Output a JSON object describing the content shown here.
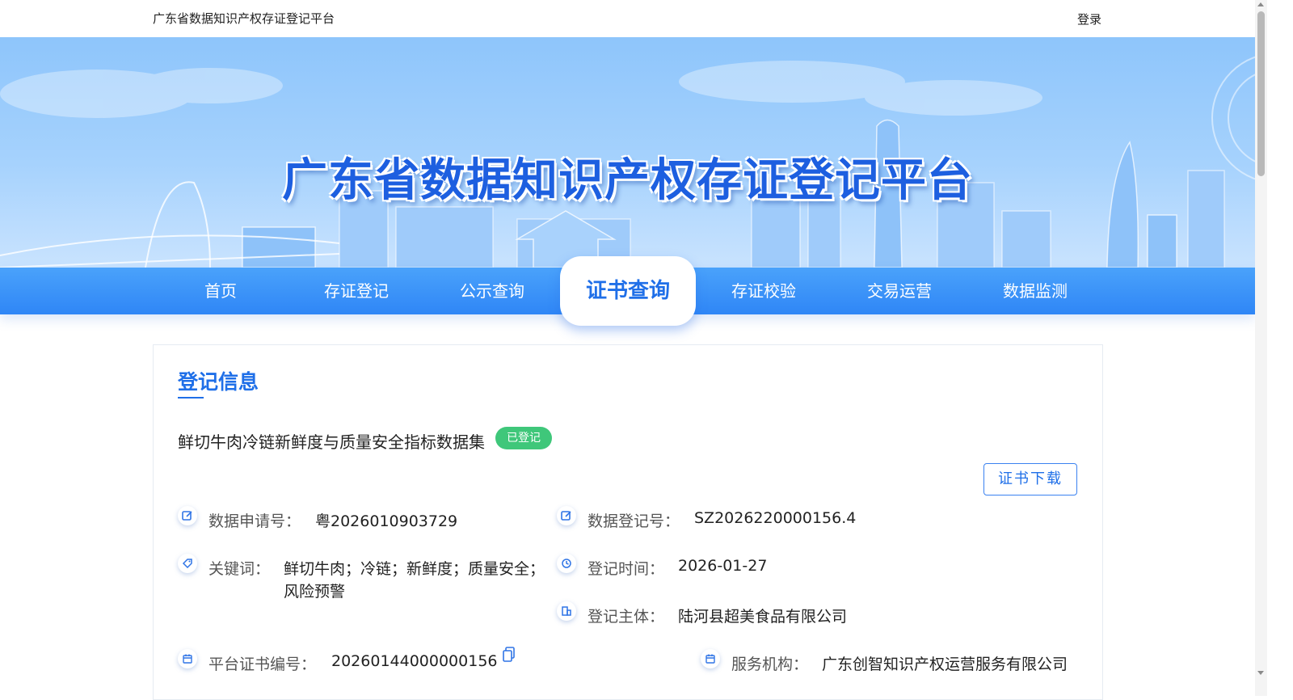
{
  "topbar": {
    "site_name": "广东省数据知识产权存证登记平台",
    "login": "登录"
  },
  "banner": {
    "headline": "广东省数据知识产权存证登记平台"
  },
  "nav": {
    "items": [
      {
        "label": "首页"
      },
      {
        "label": "存证登记"
      },
      {
        "label": "公示查询"
      },
      {
        "label": "证书查询",
        "active": true
      },
      {
        "label": "存证校验"
      },
      {
        "label": "交易运营"
      },
      {
        "label": "数据监测"
      }
    ]
  },
  "card": {
    "section_title": "登记信息",
    "dataset_name": "鲜切牛肉冷链新鲜度与质量安全指标数据集",
    "status_badge": "已登记",
    "download_button": "证书下载",
    "fields": {
      "application_no": {
        "label": "数据申请号：",
        "value": "粤2026010903729",
        "icon": "edit-icon"
      },
      "registration_no": {
        "label": "数据登记号：",
        "value": "SZ2026220000156.4",
        "icon": "edit-icon"
      },
      "keywords": {
        "label": "关键词：",
        "value_line1": "鲜切牛肉；冷链；新鲜度；质量安全；",
        "value_line2": "风险预警",
        "icon": "tag-icon"
      },
      "reg_time": {
        "label": "登记时间：",
        "value": "2026-01-27",
        "icon": "clock-icon"
      },
      "reg_subject": {
        "label": "登记主体：",
        "value": "陆河县超美食品有限公司",
        "icon": "building-icon"
      },
      "cert_no": {
        "label": "平台证书编号：",
        "value": "20260144000000156",
        "icon": "calendar-icon"
      },
      "service_org": {
        "label": "服务机构：",
        "value": "广东创智知识产权运营服务有限公司",
        "icon": "calendar-icon"
      }
    }
  },
  "colors": {
    "primary": "#1f6fe8",
    "nav_bg": "#3a92f8",
    "badge_green": "#3fc77a"
  }
}
